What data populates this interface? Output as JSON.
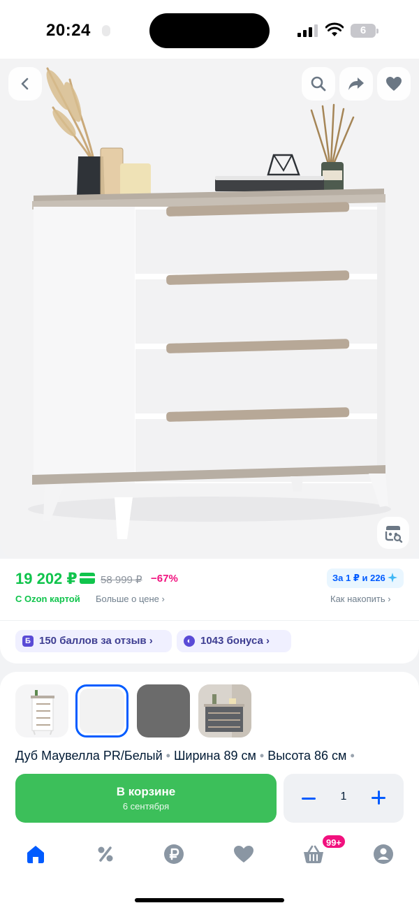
{
  "status_bar": {
    "time": "20:24",
    "battery": "6"
  },
  "hero": {
    "icons": [
      "back-icon",
      "search-icon",
      "share-icon",
      "heart-icon",
      "visual-search-icon"
    ]
  },
  "price": {
    "current": "19 202 ₽",
    "old": "58 999 ₽",
    "discount": "−67%",
    "card_note": "С Ozon картой",
    "more_link": "Больше о цене ›",
    "bonus_pill": "За 1 ₽ и 226",
    "how_collect": "Как накопить ›",
    "chips": [
      {
        "icon": "Б",
        "label": "150 баллов за отзыв ›"
      },
      {
        "icon": "◐",
        "label": "1043 бонуса ›"
      }
    ]
  },
  "variants": {
    "thumbs": [
      "white-dresser",
      "white",
      "grey",
      "grey-dresser"
    ],
    "specs": [
      "Дуб Маувелла PR/Белый",
      "Ширина 89 см",
      "Высота 86 см",
      ""
    ]
  },
  "cart": {
    "label": "В корзине",
    "sub": "6 сентября",
    "quantity": "1"
  },
  "tabbar": {
    "items": [
      "home-icon",
      "percent-icon",
      "ruble-icon",
      "heart-icon",
      "cart-icon",
      "profile-icon"
    ],
    "cart_badge": "99+"
  },
  "colors": {
    "accent": "#005bff",
    "green": "#10c44c",
    "pink": "#f1117e",
    "cart_button": "#3cbf5a"
  }
}
